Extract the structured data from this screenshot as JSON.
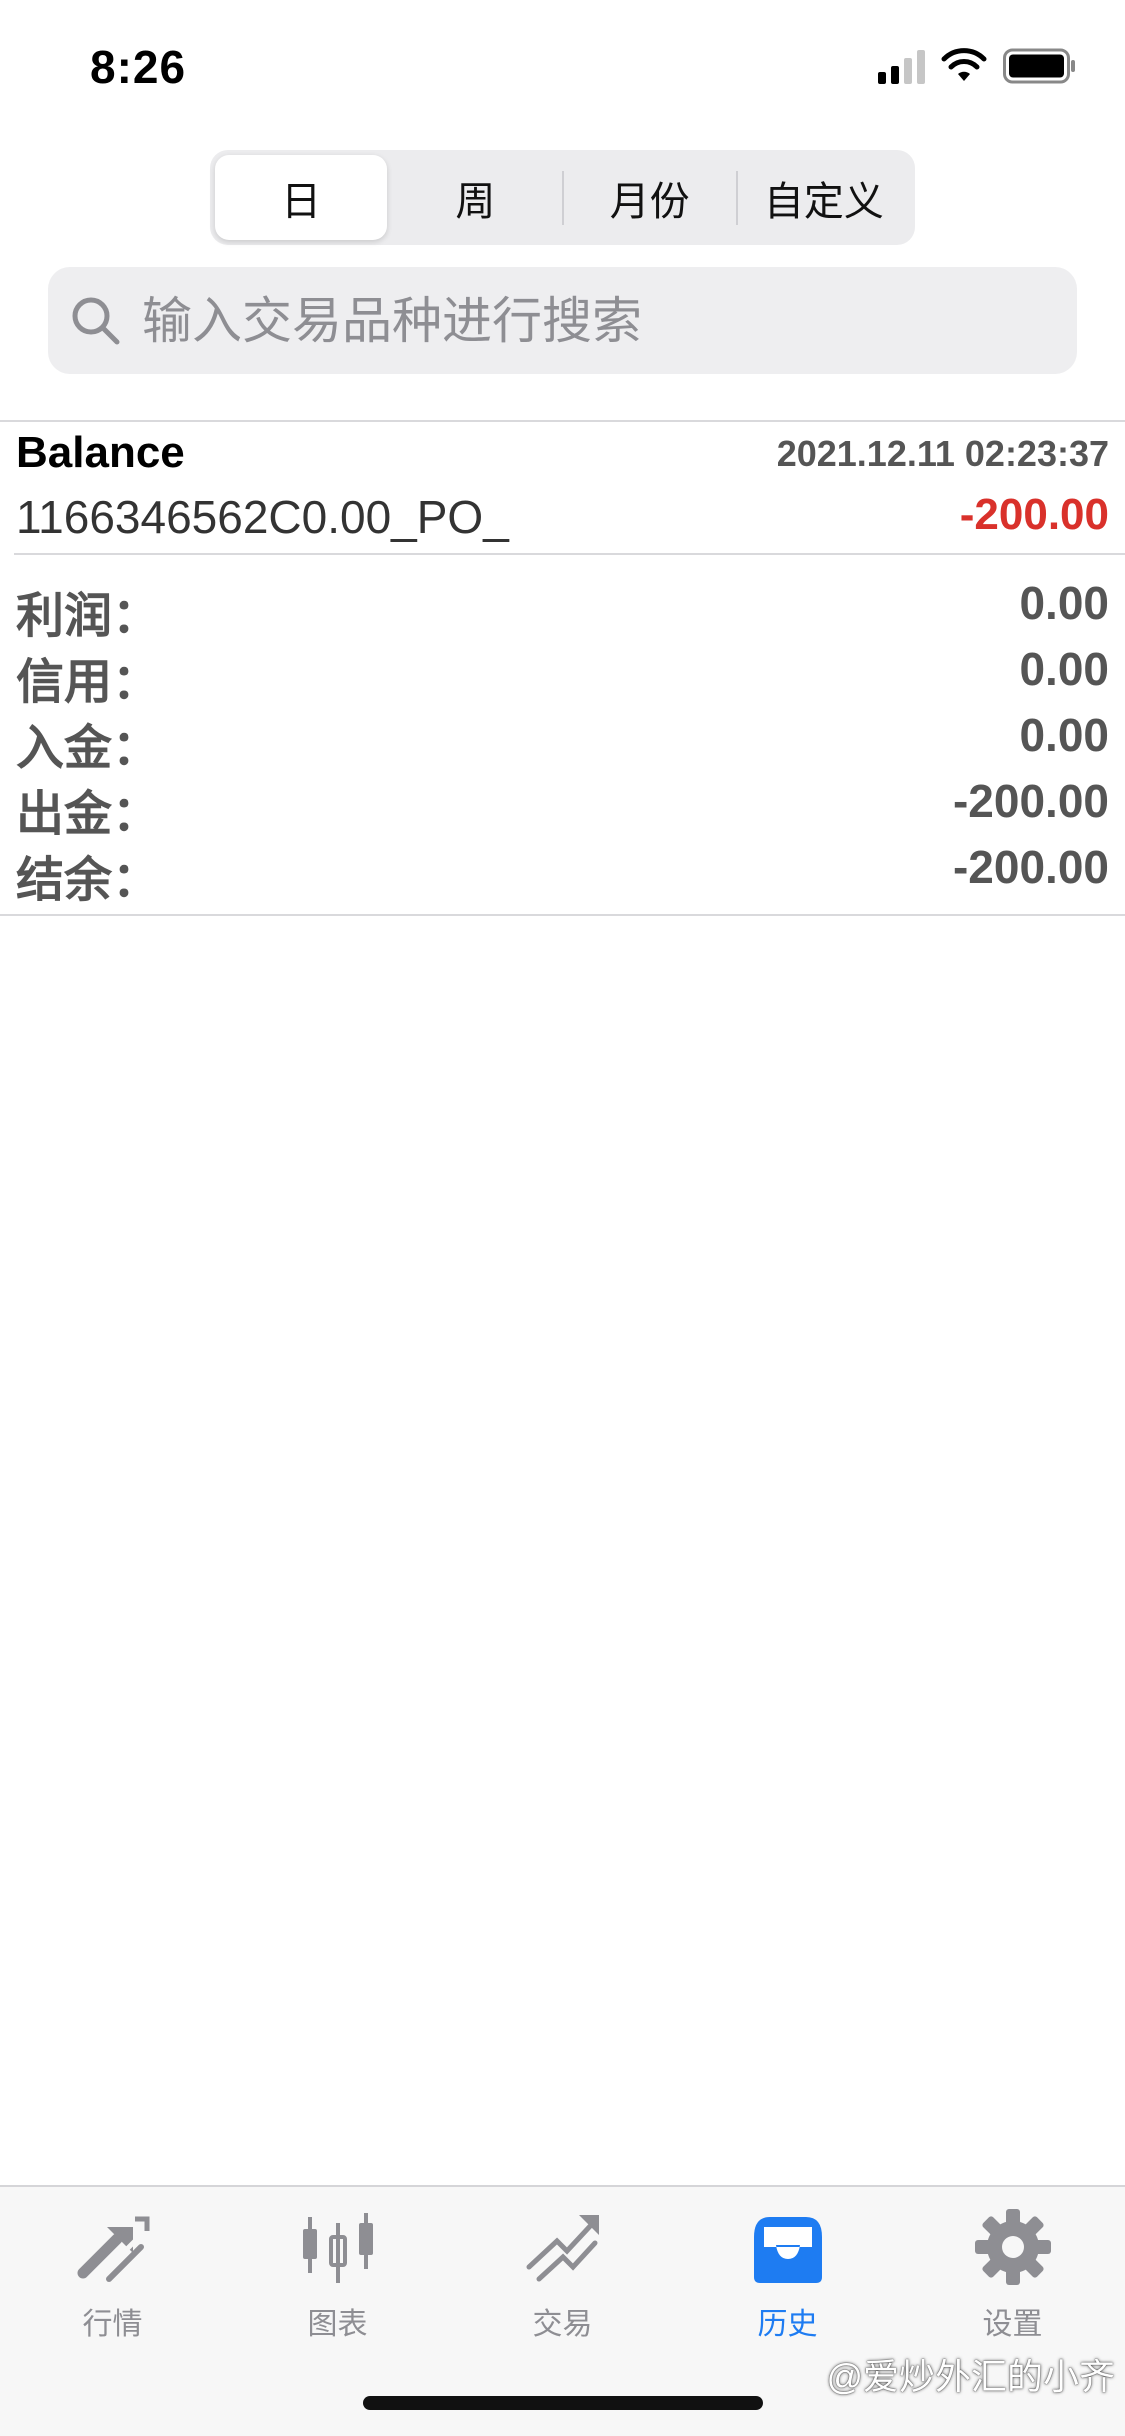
{
  "status_bar": {
    "time": "8:26"
  },
  "period_tabs": [
    {
      "label": "日",
      "active": true
    },
    {
      "label": "周",
      "active": false
    },
    {
      "label": "月份",
      "active": false
    },
    {
      "label": "自定义",
      "active": false
    }
  ],
  "search": {
    "placeholder": "输入交易品种进行搜索"
  },
  "record": {
    "title": "Balance",
    "time": "2021.12.11 02:23:37",
    "reference": "1166346562C0.00_PO_",
    "amount": "-200.00"
  },
  "summary": [
    {
      "label": "利润：",
      "value": "0.00"
    },
    {
      "label": "信用：",
      "value": "0.00"
    },
    {
      "label": "入金：",
      "value": "0.00"
    },
    {
      "label": "出金：",
      "value": "-200.00"
    },
    {
      "label": "结余：",
      "value": "-200.00"
    }
  ],
  "tab_bar": [
    {
      "label": "行情",
      "icon": "quotes-arrows-icon",
      "active": false
    },
    {
      "label": "图表",
      "icon": "candlestick-chart-icon",
      "active": false
    },
    {
      "label": "交易",
      "icon": "trade-trend-icon",
      "active": false
    },
    {
      "label": "历史",
      "icon": "history-inbox-icon",
      "active": true
    },
    {
      "label": "设置",
      "icon": "settings-gear-icon",
      "active": false
    }
  ],
  "watermark": "@爱炒外汇的小齐",
  "colors": {
    "accent": "#1e7cf2",
    "negative": "#d9312b",
    "inactive": "#8e8e93"
  }
}
